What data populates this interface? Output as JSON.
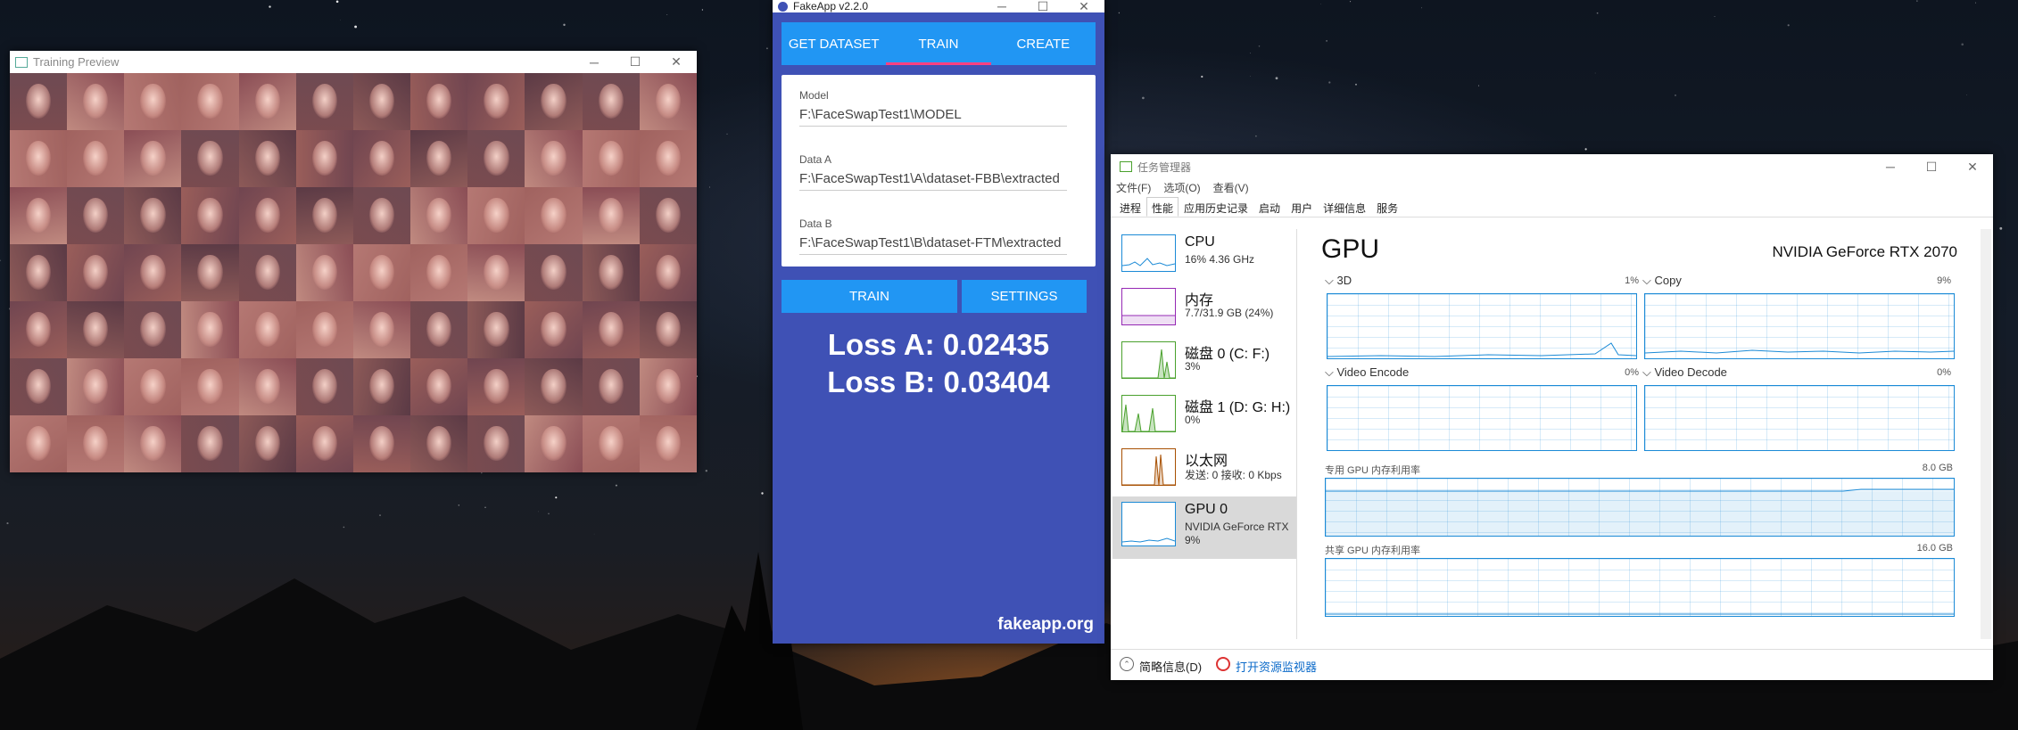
{
  "training_preview": {
    "title": "Training Preview",
    "controls": {
      "minimize": "─",
      "maximize": "☐",
      "close": "✕"
    }
  },
  "fakeapp": {
    "title": "FakeApp v2.2.0",
    "tabs": [
      "GET DATASET",
      "TRAIN",
      "CREATE"
    ],
    "active_tab": "TRAIN",
    "fields": [
      {
        "label": "Model",
        "value": "F:\\FaceSwapTest1\\MODEL"
      },
      {
        "label": "Data A",
        "value": "F:\\FaceSwapTest1\\A\\dataset-FBB\\extracted"
      },
      {
        "label": "Data B",
        "value": "F:\\FaceSwapTest1\\B\\dataset-FTM\\extracted"
      }
    ],
    "train_button": "TRAIN",
    "settings_button": "SETTINGS",
    "loss_a": "Loss A: 0.02435",
    "loss_b": "Loss B: 0.03404",
    "website": "fakeapp.org",
    "colors": {
      "background": "#3f51b5",
      "accent": "#2196f3",
      "tab_indicator": "#ff4081"
    }
  },
  "task_manager": {
    "title": "任务管理器",
    "menu": [
      "文件(F)",
      "选项(O)",
      "查看(V)"
    ],
    "tabs": [
      "进程",
      "性能",
      "应用历史记录",
      "启动",
      "用户",
      "详细信息",
      "服务"
    ],
    "active_tab": "性能",
    "sidebar": [
      {
        "title": "CPU",
        "sub": "16% 4.36 GHz",
        "sub2": "",
        "color": "#1b8ad6"
      },
      {
        "title": "内存",
        "sub": "7.7/31.9 GB (24%)",
        "sub2": "",
        "color": "#9528b4"
      },
      {
        "title": "磁盘 0 (C: F:)",
        "sub": "3%",
        "sub2": "",
        "color": "#4aa12d"
      },
      {
        "title": "磁盘 1 (D: G: H:)",
        "sub": "0%",
        "sub2": "",
        "color": "#4aa12d"
      },
      {
        "title": "以太网",
        "sub": "发送: 0 接收: 0 Kbps",
        "sub2": "",
        "color": "#a74f01"
      },
      {
        "title": "GPU 0",
        "sub": "NVIDIA GeForce RTX",
        "sub2": "9%",
        "color": "#1b8ad6"
      }
    ],
    "gpu": {
      "heading": "GPU",
      "model": "NVIDIA GeForce RTX 2070",
      "engines": [
        {
          "name": "3D",
          "pct": "1%"
        },
        {
          "name": "Copy",
          "pct": "9%"
        },
        {
          "name": "Video Encode",
          "pct": "0%"
        },
        {
          "name": "Video Decode",
          "pct": "0%"
        }
      ],
      "dedicated_label": "专用 GPU 内存利用率",
      "dedicated_max": "8.0 GB",
      "shared_label": "共享 GPU 内存利用率",
      "shared_max": "16.0 GB"
    },
    "status": {
      "brief": "简略信息(D)",
      "monitor": "打开资源监视器"
    }
  }
}
